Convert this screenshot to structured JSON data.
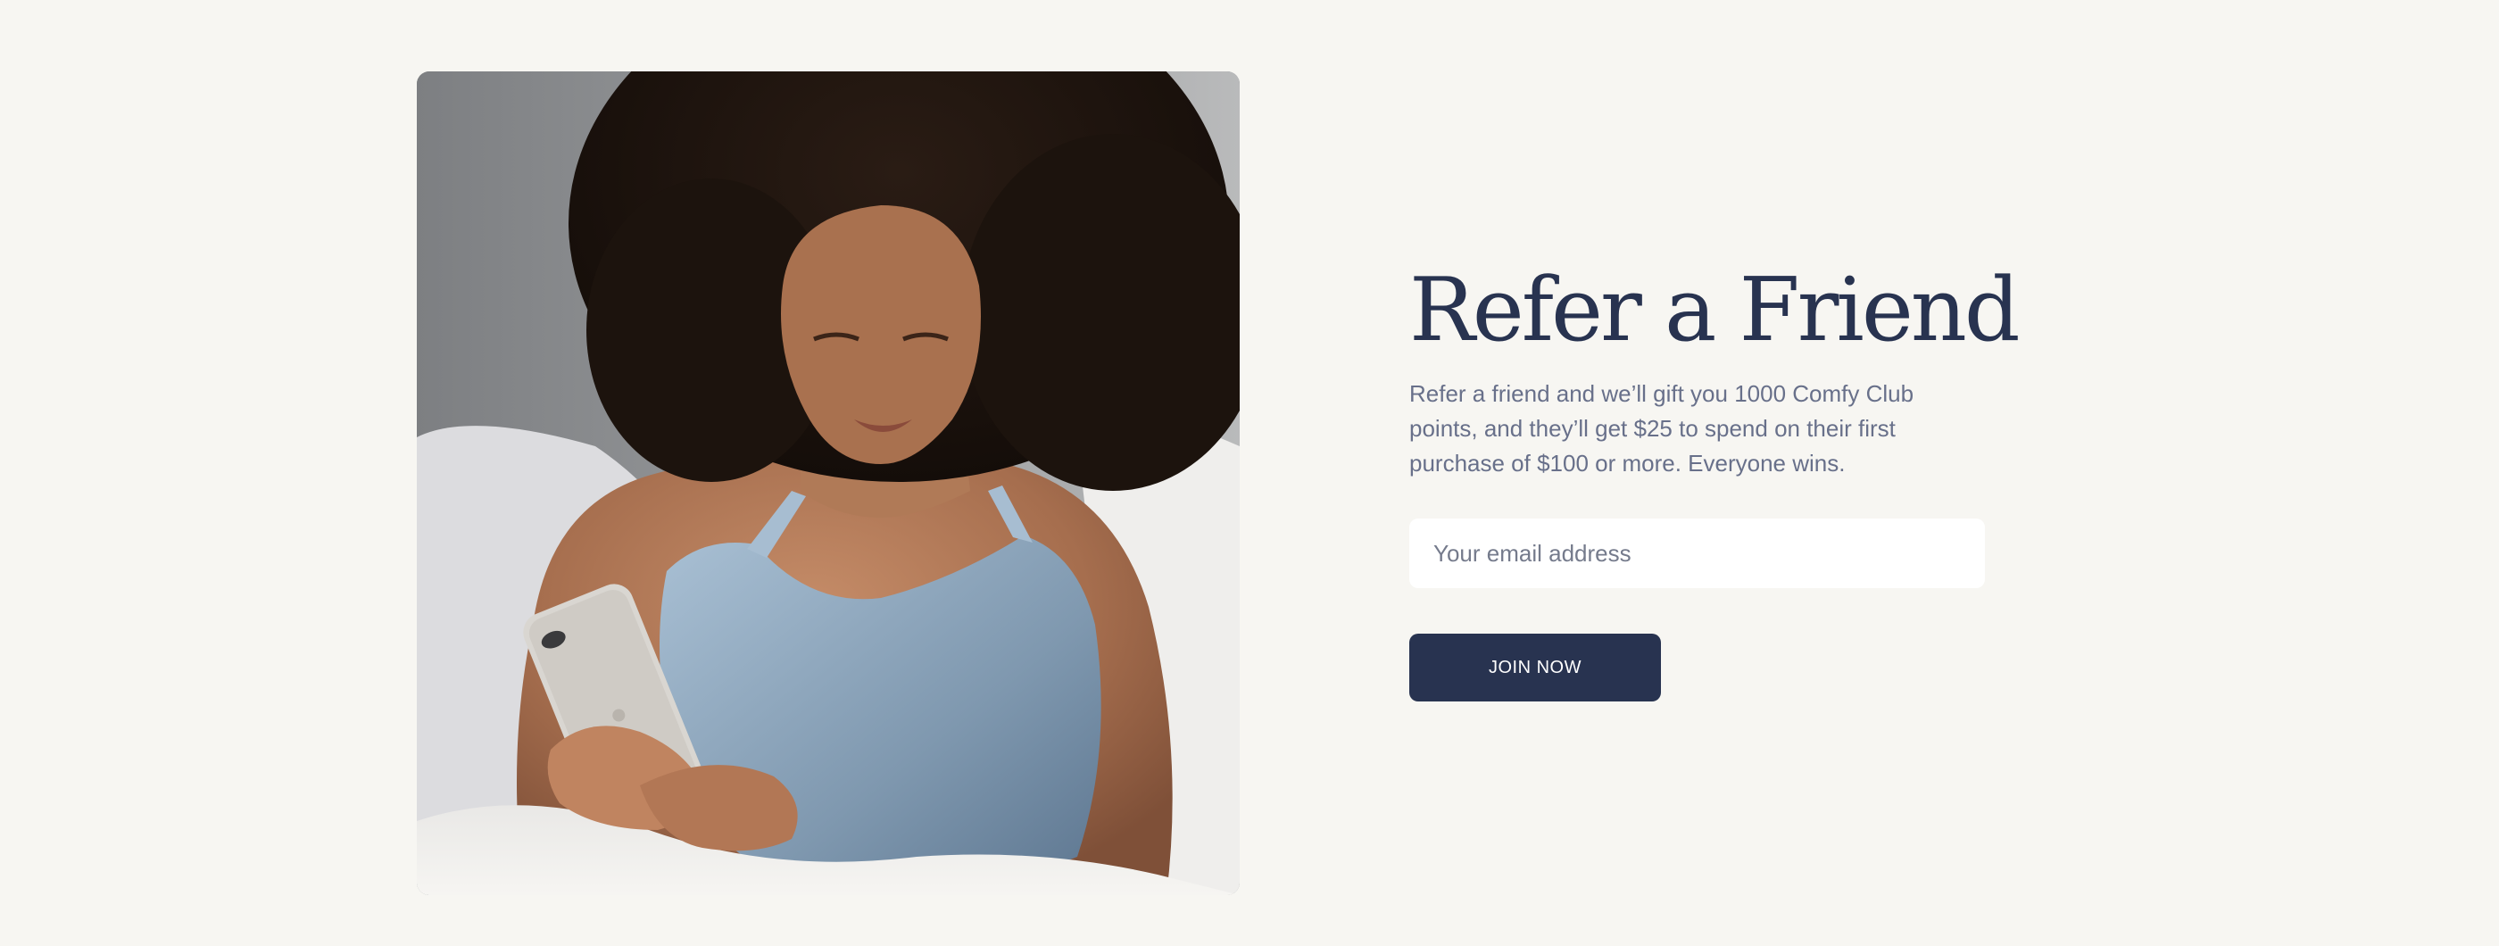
{
  "referral": {
    "title": "Refer a Friend",
    "description": "Refer a friend and we’ll gift you 1000 Comfy Club points, and they’ll get $25 to spend on their first purchase of $100 or more. Everyone wins.",
    "email_placeholder": "Your email address",
    "email_value": "",
    "button_label": "JOIN NOW"
  },
  "colors": {
    "background": "#f7f6f2",
    "accent": "#283350",
    "body_text": "#68708a",
    "input_background": "#ffffff"
  }
}
